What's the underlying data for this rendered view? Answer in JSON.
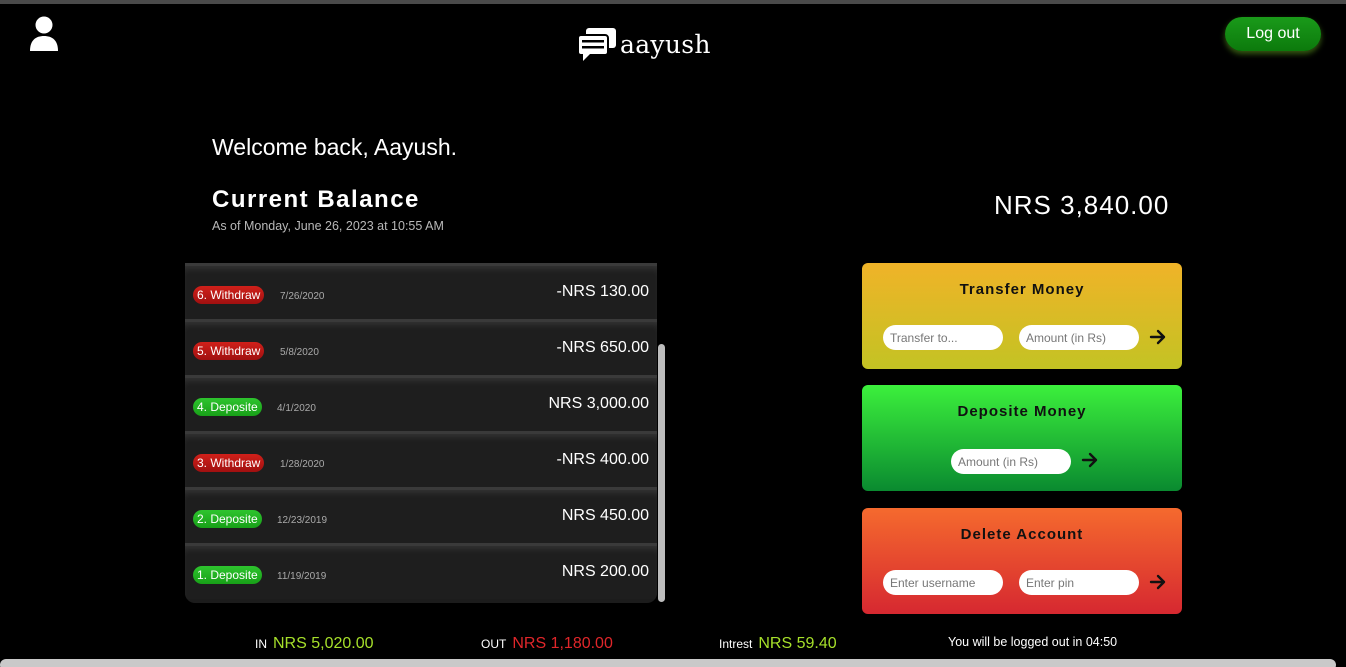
{
  "header": {
    "logo_text": "aayush",
    "logout_label": "Log out"
  },
  "welcome": "Welcome back, Aayush.",
  "balance": {
    "title": "Current Balance",
    "date_label": "As of Monday, June 26, 2023 at 10:55 AM",
    "amount": "NRS 3,840.00"
  },
  "movements": [
    {
      "label": "6. Withdraw",
      "type": "withdraw",
      "date": "7/26/2020",
      "amount": "-NRS 130.00"
    },
    {
      "label": "5. Withdraw",
      "type": "withdraw",
      "date": "5/8/2020",
      "amount": "-NRS 650.00"
    },
    {
      "label": "4. Deposite",
      "type": "deposit",
      "date": "4/1/2020",
      "amount": "NRS 3,000.00"
    },
    {
      "label": "3. Withdraw",
      "type": "withdraw",
      "date": "1/28/2020",
      "amount": "-NRS 400.00"
    },
    {
      "label": "2. Deposite",
      "type": "deposit",
      "date": "12/23/2019",
      "amount": "NRS 450.00"
    },
    {
      "label": "1. Deposite",
      "type": "deposit",
      "date": "11/19/2019",
      "amount": "NRS 200.00"
    }
  ],
  "operations": {
    "transfer": {
      "title": "Transfer Money",
      "to_placeholder": "Transfer to...",
      "amount_placeholder": "Amount (in Rs)"
    },
    "deposit": {
      "title": "Deposite Money",
      "amount_placeholder": "Amount (in Rs)"
    },
    "delete": {
      "title": "Delete Account",
      "user_placeholder": "Enter username",
      "pin_placeholder": "Enter pin"
    }
  },
  "summary": {
    "in_label": "IN",
    "in_value": "NRS 5,020.00",
    "out_label": "OUT",
    "out_value": "NRS 1,180.00",
    "interest_label": "Intrest",
    "interest_value": "NRS 59.40"
  },
  "logout_timer": "You will be logged out in 04:50",
  "colors": {
    "withdraw": "#c0181a",
    "deposit": "#22b422",
    "positive": "#a6e02a",
    "negative": "#e0262a"
  }
}
